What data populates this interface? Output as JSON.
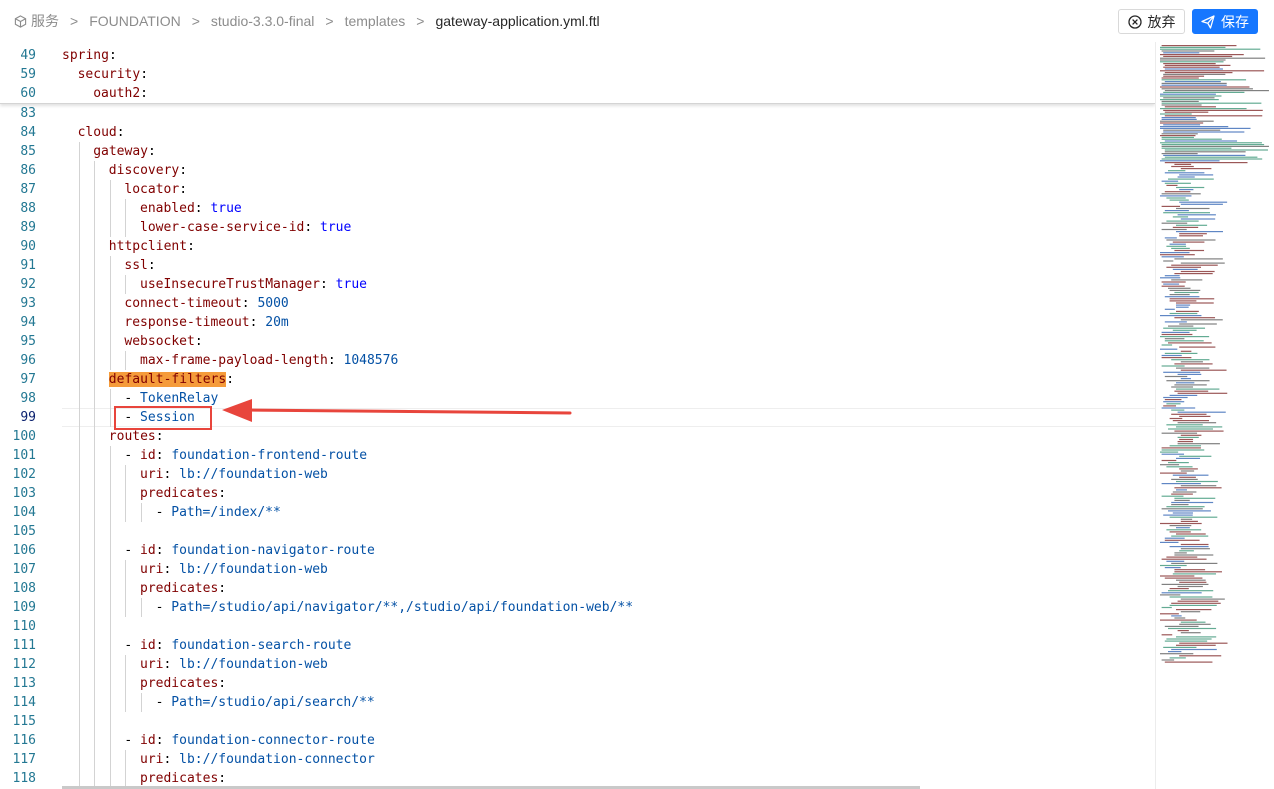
{
  "header": {
    "breadcrumb": [
      {
        "label": "服务",
        "icon": "cube-icon"
      },
      {
        "label": "FOUNDATION"
      },
      {
        "label": "studio-3.3.0-final"
      },
      {
        "label": "templates"
      },
      {
        "label": "gateway-application.yml.ftl"
      }
    ],
    "separator": ">",
    "discard_label": "放弃",
    "save_label": "保存"
  },
  "colors": {
    "accent": "#1677ff",
    "key": "#800000",
    "value": "#0451a5",
    "boolean": "#0000ff",
    "line_number": "#237893",
    "search_highlight": "#f59b3a",
    "annotation": "#e8453c"
  },
  "editor": {
    "active_line": "99",
    "sticky_lines": [
      {
        "num": "49",
        "indent": 0,
        "tokens": [
          {
            "t": "spring",
            "c": "k"
          },
          {
            "t": ":",
            "c": "p"
          }
        ]
      },
      {
        "num": "59",
        "indent": 2,
        "tokens": [
          {
            "t": "security",
            "c": "k"
          },
          {
            "t": ":",
            "c": "p"
          }
        ]
      },
      {
        "num": "60",
        "indent": 4,
        "tokens": [
          {
            "t": "oauth2",
            "c": "k"
          },
          {
            "t": ":",
            "c": "p"
          }
        ]
      }
    ],
    "lines": [
      {
        "num": "83",
        "indent": 0,
        "tokens": []
      },
      {
        "num": "84",
        "indent": 2,
        "tokens": [
          {
            "t": "cloud",
            "c": "k"
          },
          {
            "t": ":",
            "c": "p"
          }
        ]
      },
      {
        "num": "85",
        "indent": 4,
        "tokens": [
          {
            "t": "gateway",
            "c": "k"
          },
          {
            "t": ":",
            "c": "p"
          }
        ]
      },
      {
        "num": "86",
        "indent": 6,
        "tokens": [
          {
            "t": "discovery",
            "c": "k"
          },
          {
            "t": ":",
            "c": "p"
          }
        ]
      },
      {
        "num": "87",
        "indent": 8,
        "tokens": [
          {
            "t": "locator",
            "c": "k"
          },
          {
            "t": ":",
            "c": "p"
          }
        ]
      },
      {
        "num": "88",
        "indent": 10,
        "tokens": [
          {
            "t": "enabled",
            "c": "k"
          },
          {
            "t": ": ",
            "c": "p"
          },
          {
            "t": "true",
            "c": "s"
          }
        ]
      },
      {
        "num": "89",
        "indent": 10,
        "tokens": [
          {
            "t": "lower-case-service-id",
            "c": "k"
          },
          {
            "t": ": ",
            "c": "p"
          },
          {
            "t": "true",
            "c": "s"
          }
        ]
      },
      {
        "num": "90",
        "indent": 6,
        "tokens": [
          {
            "t": "httpclient",
            "c": "k"
          },
          {
            "t": ":",
            "c": "p"
          }
        ]
      },
      {
        "num": "91",
        "indent": 8,
        "tokens": [
          {
            "t": "ssl",
            "c": "k"
          },
          {
            "t": ":",
            "c": "p"
          }
        ]
      },
      {
        "num": "92",
        "indent": 10,
        "tokens": [
          {
            "t": "useInsecureTrustManager",
            "c": "k"
          },
          {
            "t": ": ",
            "c": "p"
          },
          {
            "t": "true",
            "c": "s"
          }
        ]
      },
      {
        "num": "93",
        "indent": 8,
        "tokens": [
          {
            "t": "connect-timeout",
            "c": "k"
          },
          {
            "t": ": ",
            "c": "p"
          },
          {
            "t": "5000",
            "c": "v"
          }
        ]
      },
      {
        "num": "94",
        "indent": 8,
        "tokens": [
          {
            "t": "response-timeout",
            "c": "k"
          },
          {
            "t": ": ",
            "c": "p"
          },
          {
            "t": "20m",
            "c": "v"
          }
        ]
      },
      {
        "num": "95",
        "indent": 8,
        "tokens": [
          {
            "t": "websocket",
            "c": "k"
          },
          {
            "t": ":",
            "c": "p"
          }
        ]
      },
      {
        "num": "96",
        "indent": 10,
        "tokens": [
          {
            "t": "max-frame-payload-length",
            "c": "k"
          },
          {
            "t": ": ",
            "c": "p"
          },
          {
            "t": "1048576",
            "c": "v"
          }
        ]
      },
      {
        "num": "97",
        "indent": 6,
        "tokens": [
          {
            "t": "default-filters",
            "c": "k hl"
          },
          {
            "t": ":",
            "c": "p"
          }
        ]
      },
      {
        "num": "98",
        "indent": 8,
        "tokens": [
          {
            "t": "- ",
            "c": "p"
          },
          {
            "t": "TokenRelay",
            "c": "v"
          }
        ]
      },
      {
        "num": "99",
        "indent": 8,
        "tokens": [
          {
            "t": "- ",
            "c": "p"
          },
          {
            "t": "Session",
            "c": "v"
          }
        ]
      },
      {
        "num": "100",
        "indent": 6,
        "tokens": [
          {
            "t": "routes",
            "c": "k"
          },
          {
            "t": ":",
            "c": "p"
          }
        ]
      },
      {
        "num": "101",
        "indent": 8,
        "tokens": [
          {
            "t": "- ",
            "c": "p"
          },
          {
            "t": "id",
            "c": "k"
          },
          {
            "t": ": ",
            "c": "p"
          },
          {
            "t": "foundation-frontend-route",
            "c": "v"
          }
        ]
      },
      {
        "num": "102",
        "indent": 10,
        "tokens": [
          {
            "t": "uri",
            "c": "k"
          },
          {
            "t": ": ",
            "c": "p"
          },
          {
            "t": "lb://foundation-web",
            "c": "v"
          }
        ]
      },
      {
        "num": "103",
        "indent": 10,
        "tokens": [
          {
            "t": "predicates",
            "c": "k"
          },
          {
            "t": ":",
            "c": "p"
          }
        ]
      },
      {
        "num": "104",
        "indent": 12,
        "tokens": [
          {
            "t": "- ",
            "c": "p"
          },
          {
            "t": "Path=/index/**",
            "c": "v"
          }
        ]
      },
      {
        "num": "105",
        "indent": 0,
        "tokens": []
      },
      {
        "num": "106",
        "indent": 8,
        "tokens": [
          {
            "t": "- ",
            "c": "p"
          },
          {
            "t": "id",
            "c": "k"
          },
          {
            "t": ": ",
            "c": "p"
          },
          {
            "t": "foundation-navigator-route",
            "c": "v"
          }
        ]
      },
      {
        "num": "107",
        "indent": 10,
        "tokens": [
          {
            "t": "uri",
            "c": "k"
          },
          {
            "t": ": ",
            "c": "p"
          },
          {
            "t": "lb://foundation-web",
            "c": "v"
          }
        ]
      },
      {
        "num": "108",
        "indent": 10,
        "tokens": [
          {
            "t": "predicates",
            "c": "k"
          },
          {
            "t": ":",
            "c": "p"
          }
        ]
      },
      {
        "num": "109",
        "indent": 12,
        "tokens": [
          {
            "t": "- ",
            "c": "p"
          },
          {
            "t": "Path=/studio/api/navigator/**,/studio/api/foundation-web/**",
            "c": "v"
          }
        ]
      },
      {
        "num": "110",
        "indent": 0,
        "tokens": []
      },
      {
        "num": "111",
        "indent": 8,
        "tokens": [
          {
            "t": "- ",
            "c": "p"
          },
          {
            "t": "id",
            "c": "k"
          },
          {
            "t": ": ",
            "c": "p"
          },
          {
            "t": "foundation-search-route",
            "c": "v"
          }
        ]
      },
      {
        "num": "112",
        "indent": 10,
        "tokens": [
          {
            "t": "uri",
            "c": "k"
          },
          {
            "t": ": ",
            "c": "p"
          },
          {
            "t": "lb://foundation-web",
            "c": "v"
          }
        ]
      },
      {
        "num": "113",
        "indent": 10,
        "tokens": [
          {
            "t": "predicates",
            "c": "k"
          },
          {
            "t": ":",
            "c": "p"
          }
        ]
      },
      {
        "num": "114",
        "indent": 12,
        "tokens": [
          {
            "t": "- ",
            "c": "p"
          },
          {
            "t": "Path=/studio/api/search/**",
            "c": "v"
          }
        ]
      },
      {
        "num": "115",
        "indent": 0,
        "tokens": []
      },
      {
        "num": "116",
        "indent": 8,
        "tokens": [
          {
            "t": "- ",
            "c": "p"
          },
          {
            "t": "id",
            "c": "k"
          },
          {
            "t": ": ",
            "c": "p"
          },
          {
            "t": "foundation-connector-route",
            "c": "v"
          }
        ]
      },
      {
        "num": "117",
        "indent": 10,
        "tokens": [
          {
            "t": "uri",
            "c": "k"
          },
          {
            "t": ": ",
            "c": "p"
          },
          {
            "t": "lb://foundation-connector",
            "c": "v"
          }
        ]
      },
      {
        "num": "118",
        "indent": 10,
        "tokens": [
          {
            "t": "predicates",
            "c": "k"
          },
          {
            "t": ":",
            "c": "p"
          }
        ]
      }
    ]
  }
}
